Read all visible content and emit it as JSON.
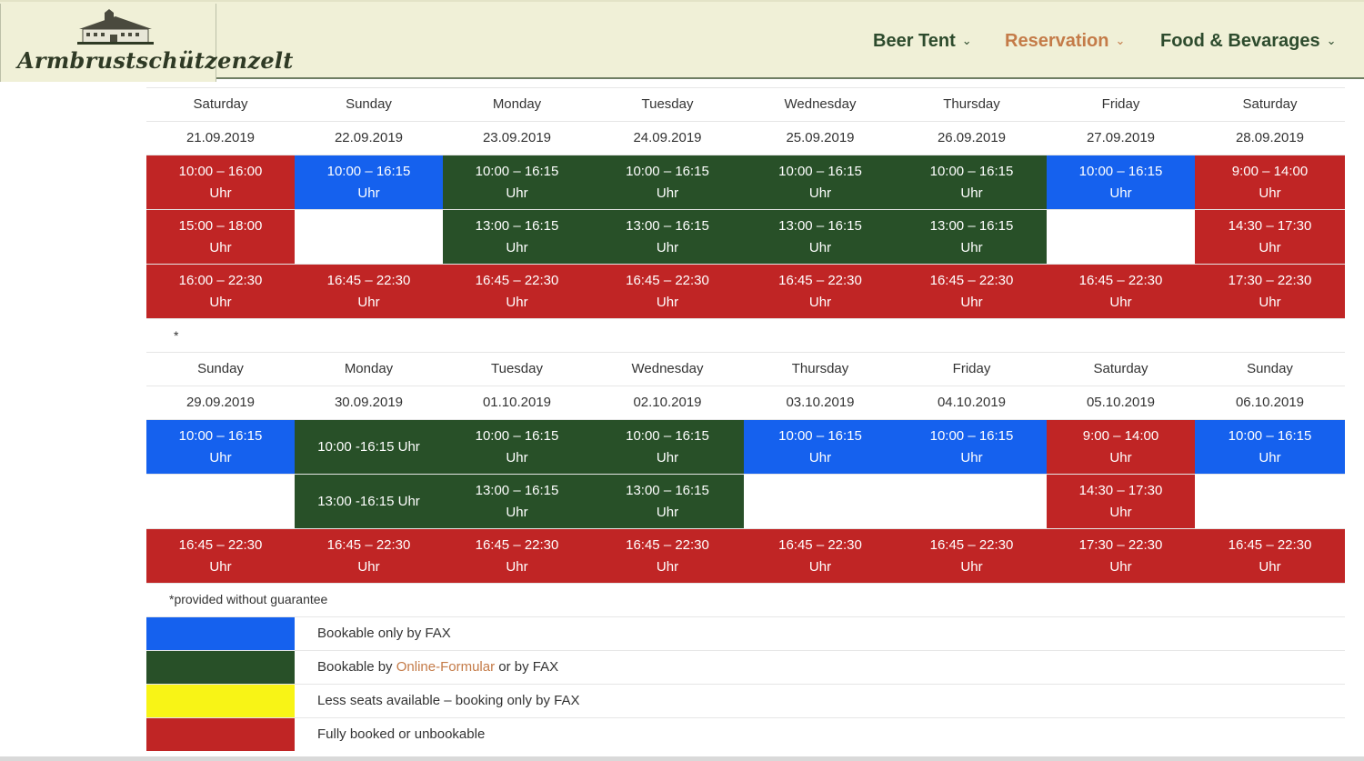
{
  "site": {
    "name": "Armbrustschützenzelt"
  },
  "nav": [
    {
      "label": "Beer Tent",
      "active": false
    },
    {
      "label": "Reservation",
      "active": true
    },
    {
      "label": "Food & Bevarages",
      "active": false
    }
  ],
  "colors": {
    "blue": "#1561ee",
    "green": "#285028",
    "red": "#c02525",
    "yellow": "#f8f416",
    "accent": "#c47b48"
  },
  "week1": {
    "days": [
      "Saturday",
      "Sunday",
      "Monday",
      "Tuesday",
      "Wednesday",
      "Thursday",
      "Friday",
      "Saturday"
    ],
    "dates": [
      "21.09.2019",
      "22.09.2019",
      "23.09.2019",
      "24.09.2019",
      "25.09.2019",
      "26.09.2019",
      "27.09.2019",
      "28.09.2019"
    ],
    "slots": [
      [
        {
          "color": "red",
          "l1": "10:00 – 16:00",
          "l2": "Uhr"
        },
        {
          "color": "blue",
          "l1": "10:00 – 16:15",
          "l2": "Uhr"
        },
        {
          "color": "green",
          "l1": "10:00 – 16:15",
          "l2": "Uhr"
        },
        {
          "color": "green",
          "l1": "10:00 – 16:15",
          "l2": "Uhr"
        },
        {
          "color": "green",
          "l1": "10:00 – 16:15",
          "l2": "Uhr"
        },
        {
          "color": "green",
          "l1": "10:00 – 16:15",
          "l2": "Uhr"
        },
        {
          "color": "blue",
          "l1": "10:00 – 16:15",
          "l2": "Uhr"
        },
        {
          "color": "red",
          "l1": "9:00 – 14:00",
          "l2": "Uhr"
        }
      ],
      [
        {
          "color": "red",
          "l1": "15:00 – 18:00",
          "l2": "Uhr"
        },
        {
          "color": "white",
          "l1": "",
          "l2": ""
        },
        {
          "color": "green",
          "l1": "13:00 – 16:15",
          "l2": "Uhr"
        },
        {
          "color": "green",
          "l1": "13:00 – 16:15",
          "l2": "Uhr"
        },
        {
          "color": "green",
          "l1": "13:00 – 16:15",
          "l2": "Uhr"
        },
        {
          "color": "green",
          "l1": "13:00 – 16:15",
          "l2": "Uhr"
        },
        {
          "color": "white",
          "l1": "",
          "l2": ""
        },
        {
          "color": "red",
          "l1": "14:30 – 17:30",
          "l2": "Uhr"
        }
      ],
      [
        {
          "color": "red",
          "l1": "16:00 – 22:30",
          "l2": "Uhr"
        },
        {
          "color": "red",
          "l1": "16:45 – 22:30",
          "l2": "Uhr"
        },
        {
          "color": "red",
          "l1": "16:45 – 22:30",
          "l2": "Uhr"
        },
        {
          "color": "red",
          "l1": "16:45 – 22:30",
          "l2": "Uhr"
        },
        {
          "color": "red",
          "l1": "16:45 – 22:30",
          "l2": "Uhr"
        },
        {
          "color": "red",
          "l1": "16:45 – 22:30",
          "l2": "Uhr"
        },
        {
          "color": "red",
          "l1": "16:45 – 22:30",
          "l2": "Uhr"
        },
        {
          "color": "red",
          "l1": "17:30 – 22:30",
          "l2": "Uhr"
        }
      ]
    ]
  },
  "separator_note": "*",
  "week2": {
    "days": [
      "Sunday",
      "Monday",
      "Tuesday",
      "Wednesday",
      "Thursday",
      "Friday",
      "Saturday",
      "Sunday"
    ],
    "dates": [
      "29.09.2019",
      "30.09.2019",
      "01.10.2019",
      "02.10.2019",
      "03.10.2019",
      "04.10.2019",
      "05.10.2019",
      "06.10.2019"
    ],
    "slots": [
      [
        {
          "color": "blue",
          "l1": "10:00 – 16:15",
          "l2": "Uhr"
        },
        {
          "color": "green",
          "l1": "10:00 -16:15 Uhr",
          "l2": ""
        },
        {
          "color": "green",
          "l1": "10:00 – 16:15",
          "l2": "Uhr"
        },
        {
          "color": "green",
          "l1": "10:00 – 16:15",
          "l2": "Uhr"
        },
        {
          "color": "blue",
          "l1": "10:00 – 16:15",
          "l2": "Uhr"
        },
        {
          "color": "blue",
          "l1": "10:00 – 16:15",
          "l2": "Uhr"
        },
        {
          "color": "red",
          "l1": "9:00 – 14:00",
          "l2": "Uhr"
        },
        {
          "color": "blue",
          "l1": "10:00 – 16:15",
          "l2": "Uhr"
        }
      ],
      [
        {
          "color": "white",
          "l1": "",
          "l2": ""
        },
        {
          "color": "green",
          "l1": "13:00 -16:15 Uhr",
          "l2": ""
        },
        {
          "color": "green",
          "l1": "13:00 – 16:15",
          "l2": "Uhr"
        },
        {
          "color": "green",
          "l1": "13:00 – 16:15",
          "l2": "Uhr"
        },
        {
          "color": "white",
          "l1": "",
          "l2": ""
        },
        {
          "color": "white",
          "l1": "",
          "l2": ""
        },
        {
          "color": "red",
          "l1": "14:30 – 17:30",
          "l2": "Uhr"
        },
        {
          "color": "white",
          "l1": "",
          "l2": ""
        }
      ],
      [
        {
          "color": "red",
          "l1": "16:45 – 22:30",
          "l2": "Uhr"
        },
        {
          "color": "red",
          "l1": "16:45 – 22:30",
          "l2": "Uhr"
        },
        {
          "color": "red",
          "l1": "16:45 – 22:30",
          "l2": "Uhr"
        },
        {
          "color": "red",
          "l1": "16:45 – 22:30",
          "l2": "Uhr"
        },
        {
          "color": "red",
          "l1": "16:45 – 22:30",
          "l2": "Uhr"
        },
        {
          "color": "red",
          "l1": "16:45 – 22:30",
          "l2": "Uhr"
        },
        {
          "color": "red",
          "l1": "17:30 – 22:30",
          "l2": "Uhr"
        },
        {
          "color": "red",
          "l1": "16:45 – 22:30",
          "l2": "Uhr"
        }
      ]
    ]
  },
  "footnote": "*provided without guarantee",
  "legend": [
    {
      "color": "blue",
      "text": "Bookable only by FAX"
    },
    {
      "color": "green",
      "text_before": "Bookable by ",
      "link": "Online-Formular",
      "text_after": " or by FAX"
    },
    {
      "color": "yellow",
      "text": "Less seats available – booking only by FAX"
    },
    {
      "color": "red",
      "text": "Fully booked or unbookable"
    }
  ]
}
